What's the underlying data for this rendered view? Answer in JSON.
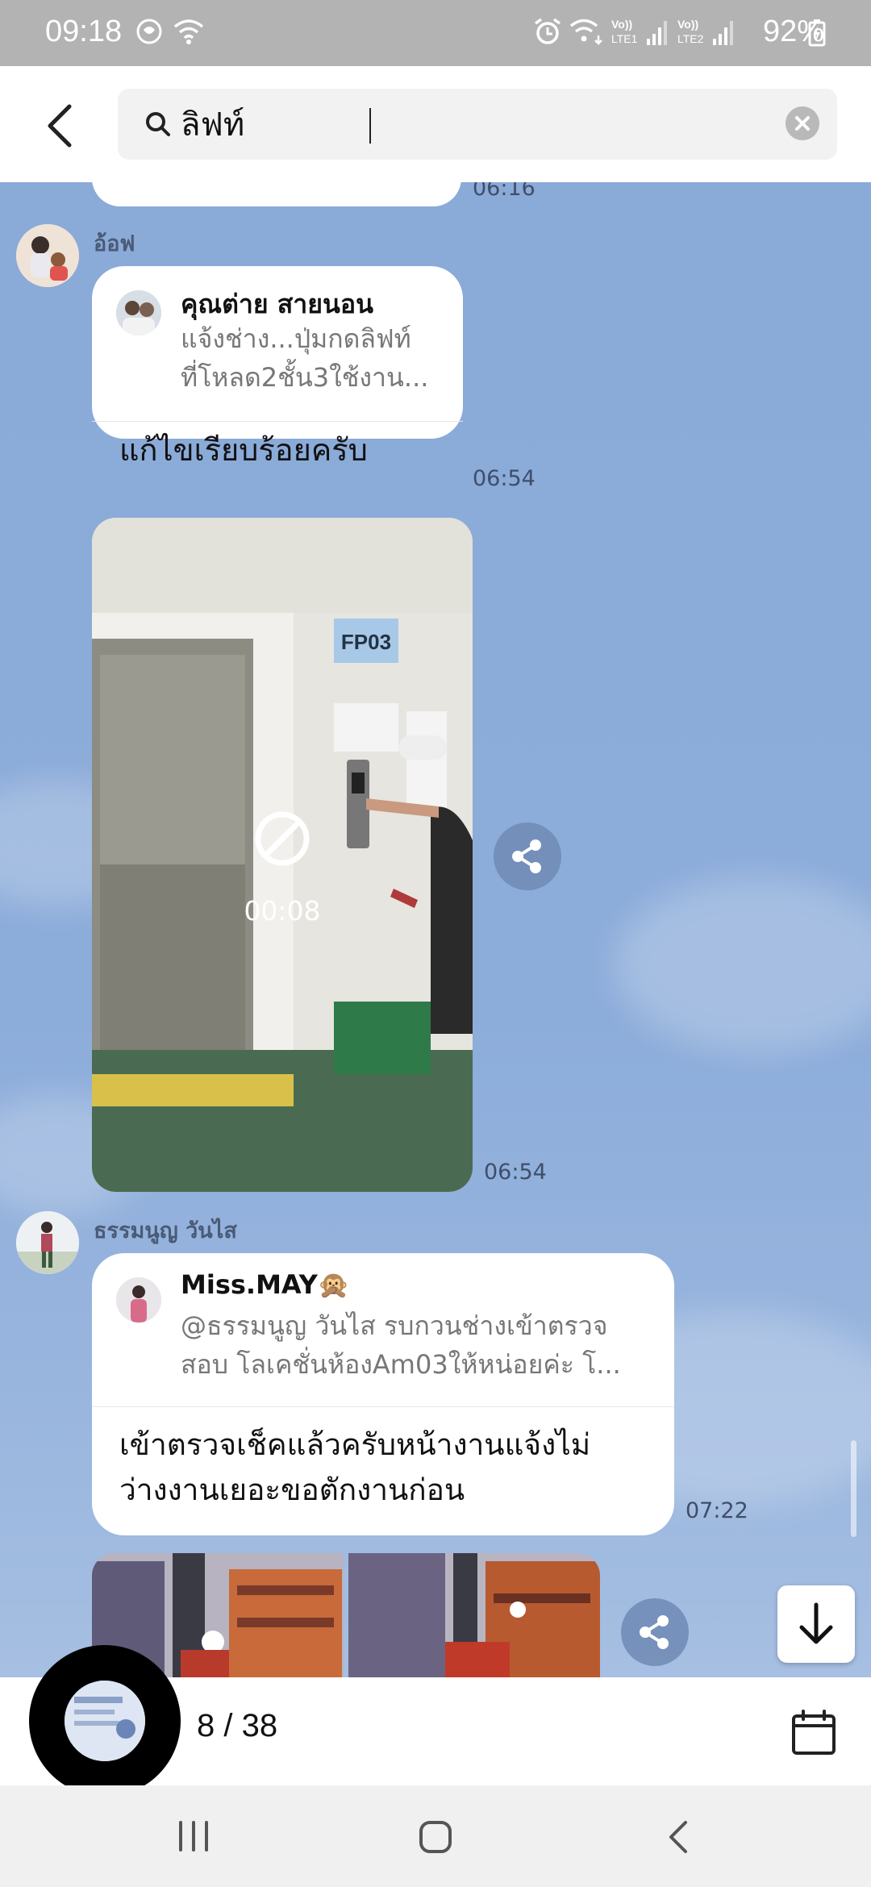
{
  "status_bar": {
    "time": "09:18",
    "battery": "92%",
    "sim1": "LTE1",
    "sim2": "LTE2"
  },
  "search": {
    "query": "ลิฟท์",
    "icon": "search-icon"
  },
  "messages": {
    "prev_timestamp": "06:16",
    "m1": {
      "sender": "อ้อฟ",
      "reply_name": "คุณต่าย สายนอน",
      "reply_text_1": "แจ้งช่าง...ปุ่มกดลิฟท์",
      "reply_text_2": "ที่โหลด2ชั้น3ใช้งาน...",
      "text": "แก้ไขเรียบร้อยครับ",
      "time": "06:54"
    },
    "video": {
      "duration": "00:08",
      "sign": "FP03",
      "time": "06:54"
    },
    "m2": {
      "sender": "ธรรมนูญ วันไส",
      "reply_name": "Miss.MAY🙊",
      "reply_text_1": "@ธรรมนูญ วันไส รบกวนช่างเข้าตรวจ",
      "reply_text_2": "สอบ โลเคชั่นห้องAm03ให้หน่อยค่ะ โ...",
      "text_1": "เข้าตรวจเช็คแล้วครับหน้างานแจ้งไม่",
      "text_2": "ว่างงานเยอะขอตักงานก่อน",
      "time": "07:22"
    }
  },
  "bottom_bar": {
    "result_counter": "8 / 38"
  },
  "colors": {
    "chat_background": "#8aaad8",
    "share_button": "#6e8ab4"
  }
}
